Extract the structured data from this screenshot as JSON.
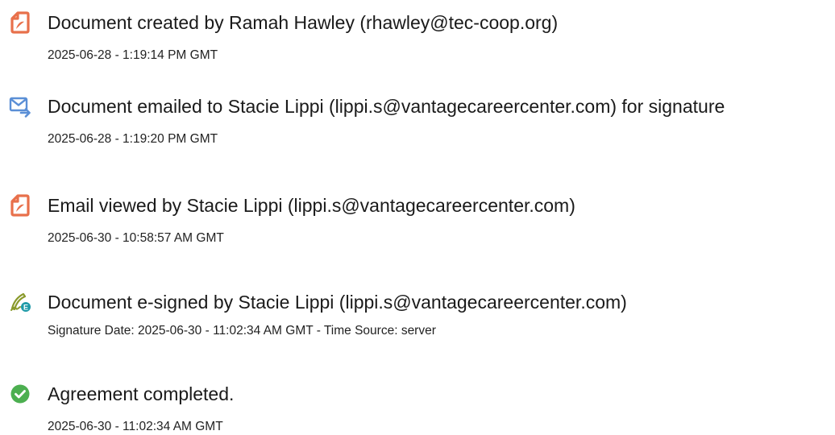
{
  "colors": {
    "doc_icon": "#E8704B",
    "email_icon": "#5B8FD6",
    "sign_icon": "#8A9A2C",
    "check_icon": "#4CAF50",
    "text": "#1a1a1a"
  },
  "events": [
    {
      "icon": "document-icon",
      "title": "Document created by Ramah Hawley (rhawley@tec-coop.org)",
      "detail": "2025-06-28 - 1:19:14 PM GMT"
    },
    {
      "icon": "email-icon",
      "title": "Document emailed to Stacie Lippi (lippi.s@vantagecareercenter.com) for signature",
      "detail": "2025-06-28 - 1:19:20 PM GMT"
    },
    {
      "icon": "document-icon",
      "title": "Email viewed by Stacie Lippi (lippi.s@vantagecareercenter.com)",
      "detail": "2025-06-30 - 10:58:57 AM GMT"
    },
    {
      "icon": "e-sign-icon",
      "title": "Document e-signed by Stacie Lippi (lippi.s@vantagecareercenter.com)",
      "detail": "Signature Date: 2025-06-30 - 11:02:34 AM GMT - Time Source: server"
    },
    {
      "icon": "check-circle-icon",
      "title": "Agreement completed.",
      "detail": "2025-06-30 - 11:02:34 AM GMT"
    }
  ]
}
